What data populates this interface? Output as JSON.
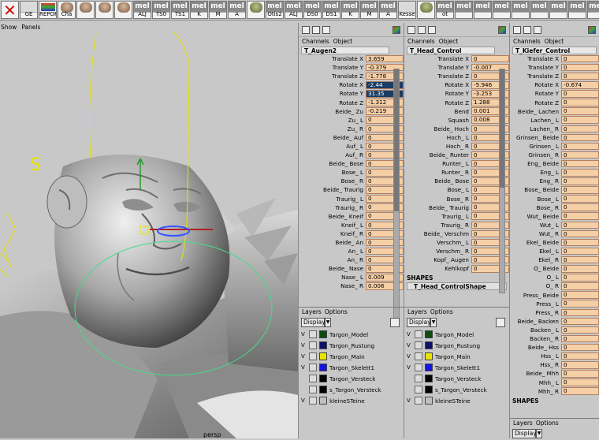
{
  "shelf": [
    {
      "label": "",
      "kind": "x"
    },
    {
      "label": "GE",
      "kind": "plain"
    },
    {
      "label": "REPORT",
      "kind": "report"
    },
    {
      "label": "Cha",
      "kind": "face"
    },
    {
      "label": "",
      "kind": "face"
    },
    {
      "label": "",
      "kind": "face"
    },
    {
      "label": "",
      "kind": "face"
    },
    {
      "label": "ALJ",
      "kind": "mel"
    },
    {
      "label": "TS0",
      "kind": "mel"
    },
    {
      "label": "TS1",
      "kind": "mel"
    },
    {
      "label": "K",
      "kind": "mel"
    },
    {
      "label": "M",
      "kind": "mel"
    },
    {
      "label": "A",
      "kind": "mel"
    },
    {
      "label": "",
      "kind": "faceg"
    },
    {
      "label": "Otis2",
      "kind": "mel"
    },
    {
      "label": "ALJ",
      "kind": "mel"
    },
    {
      "label": "DS0",
      "kind": "mel"
    },
    {
      "label": "DS1",
      "kind": "mel"
    },
    {
      "label": "K",
      "kind": "mel"
    },
    {
      "label": "M",
      "kind": "mel"
    },
    {
      "label": "A",
      "kind": "mel"
    },
    {
      "label": "Kesse",
      "kind": "plain"
    },
    {
      "label": "",
      "kind": "faceg"
    },
    {
      "label": "ot",
      "kind": "mel"
    },
    {
      "label": "",
      "kind": "mel"
    },
    {
      "label": "",
      "kind": "mel"
    },
    {
      "label": "",
      "kind": "mel"
    },
    {
      "label": "",
      "kind": "mel"
    },
    {
      "label": "",
      "kind": "mel"
    },
    {
      "label": "",
      "kind": "mel"
    },
    {
      "label": "",
      "kind": "mel"
    },
    {
      "label": "",
      "kind": "mel"
    }
  ],
  "mel_text": "mel",
  "viewport": {
    "menu": [
      "Show",
      "Panels"
    ],
    "label": "persp"
  },
  "cb_menu": [
    "Channels",
    "Object"
  ],
  "layers_menu": [
    "Layers",
    "Options"
  ],
  "display_label": "Display",
  "layers": [
    {
      "name": "Targon_Model",
      "color": "#0e4a12",
      "v": "V"
    },
    {
      "name": "Targon_Rustung",
      "color": "#10106a",
      "v": "V"
    },
    {
      "name": "Targon_Main",
      "color": "#e6e600",
      "v": "V"
    },
    {
      "name": "Targon_Skelett1",
      "color": "#1414e0",
      "v": "V"
    },
    {
      "name": "Targon_Versteck",
      "color": "#000000",
      "v": ""
    },
    {
      "name": "s_Targon_Versteck",
      "color": "#000000",
      "v": ""
    },
    {
      "name": "kleineSTeine",
      "color": "#c0c0c0",
      "v": "V"
    }
  ],
  "cb1": {
    "object": "T_Augen2",
    "channels": [
      {
        "l": "Translate X",
        "v": "3.659"
      },
      {
        "l": "Translate Y",
        "v": "-0.379"
      },
      {
        "l": "Translate Z",
        "v": "-1.778"
      },
      {
        "l": "Rotate X",
        "v": "-2.44",
        "s": true
      },
      {
        "l": "Rotate Y",
        "v": "31.35",
        "s": true
      },
      {
        "l": "Rotate Z",
        "v": "-1.312"
      },
      {
        "l": "Beide_ Zu",
        "v": "-0.219"
      },
      {
        "l": "Zu_ L",
        "v": "0"
      },
      {
        "l": "Zu_ R",
        "v": "0"
      },
      {
        "l": "Beide_ Auf",
        "v": "0"
      },
      {
        "l": "Auf_ L",
        "v": "0"
      },
      {
        "l": "Auf_ R",
        "v": "0"
      },
      {
        "l": "Beide_ Bose",
        "v": "0"
      },
      {
        "l": "Bose_ L",
        "v": "0"
      },
      {
        "l": "Bose_ R",
        "v": "0"
      },
      {
        "l": "Beide_ Traurig",
        "v": "0"
      },
      {
        "l": "Traurig_ L",
        "v": "0"
      },
      {
        "l": "Traurig_ R",
        "v": "0"
      },
      {
        "l": "Beide_ Kneif",
        "v": "0"
      },
      {
        "l": "Kneif_ L",
        "v": "0"
      },
      {
        "l": "Kneif_ R",
        "v": "0"
      },
      {
        "l": "Beide_ An",
        "v": "0"
      },
      {
        "l": "An_ L",
        "v": "0"
      },
      {
        "l": "An_ R",
        "v": "0"
      },
      {
        "l": "Beide_ Nase",
        "v": "0"
      },
      {
        "l": "Nase_ L",
        "v": "0.009"
      },
      {
        "l": "Nase_ R",
        "v": "0.006"
      }
    ]
  },
  "cb2": {
    "object": "T_Head_Control",
    "channels": [
      {
        "l": "Translate X",
        "v": "0"
      },
      {
        "l": "Translate Y",
        "v": "-0.007"
      },
      {
        "l": "Translate Z",
        "v": "0"
      },
      {
        "l": "Rotate X",
        "v": "-5.946"
      },
      {
        "l": "Rotate Y",
        "v": "-3.253"
      },
      {
        "l": "Rotate Z",
        "v": "1.288"
      },
      {
        "l": "Bend",
        "v": "0.001"
      },
      {
        "l": "Squash",
        "v": "0.008"
      },
      {
        "l": "Beide_ Hoch",
        "v": "0"
      },
      {
        "l": "Hoch_ L",
        "v": "0"
      },
      {
        "l": "Hoch_ R",
        "v": "0"
      },
      {
        "l": "Beide_ Runter",
        "v": "0"
      },
      {
        "l": "Runter_ L",
        "v": "0"
      },
      {
        "l": "Runter_ R",
        "v": "0"
      },
      {
        "l": "Beide_ Bose",
        "v": "0"
      },
      {
        "l": "Bose_ L",
        "v": "0"
      },
      {
        "l": "Bose_ R",
        "v": "0"
      },
      {
        "l": "Beide_ Traurig",
        "v": "0"
      },
      {
        "l": "Traurig_ L",
        "v": "0"
      },
      {
        "l": "Traurig_ R",
        "v": "0"
      },
      {
        "l": "Beide_ Verschm",
        "v": "0"
      },
      {
        "l": "Verschm_ L",
        "v": "0"
      },
      {
        "l": "Verschm_ R",
        "v": "0"
      },
      {
        "l": "Kopf_ Augen",
        "v": "0"
      },
      {
        "l": "Kehlkopf",
        "v": "0"
      }
    ],
    "shapes_label": "SHAPES",
    "shape": "T_Head_ControlShape"
  },
  "cb3": {
    "object": "T_Kiefer_Control",
    "channels": [
      {
        "l": "Translate X",
        "v": "0"
      },
      {
        "l": "Translate Y",
        "v": "0"
      },
      {
        "l": "Translate Z",
        "v": "0"
      },
      {
        "l": "Rotate X",
        "v": "-0.674"
      },
      {
        "l": "Rotate Y",
        "v": "0"
      },
      {
        "l": "Rotate Z",
        "v": "0"
      },
      {
        "l": "Beide_ Lachen",
        "v": "0"
      },
      {
        "l": "Lachen_ L",
        "v": "0"
      },
      {
        "l": "Lachen_ R",
        "v": "0"
      },
      {
        "l": "Grinsen_ Beide",
        "v": "0"
      },
      {
        "l": "Grinsen_ L",
        "v": "0"
      },
      {
        "l": "Grinsen_ R",
        "v": "0"
      },
      {
        "l": "Eng_ Beide",
        "v": "0"
      },
      {
        "l": "Eng_ L",
        "v": "0"
      },
      {
        "l": "Eng_ R",
        "v": "0"
      },
      {
        "l": "Bose_ Beide",
        "v": "0"
      },
      {
        "l": "Bose_ L",
        "v": "0"
      },
      {
        "l": "Bose_ R",
        "v": "0"
      },
      {
        "l": "Wut_ Beide",
        "v": "0"
      },
      {
        "l": "Wut_ L",
        "v": "0"
      },
      {
        "l": "Wut_ R",
        "v": "0"
      },
      {
        "l": "Ekel_ Beide",
        "v": "0"
      },
      {
        "l": "Ekel_ L",
        "v": "0"
      },
      {
        "l": "Ekel_ R",
        "v": "0"
      },
      {
        "l": "O_ Beide",
        "v": "0"
      },
      {
        "l": "O_ L",
        "v": "0"
      },
      {
        "l": "O_ R",
        "v": "0"
      },
      {
        "l": "Press_ Beide",
        "v": "0"
      },
      {
        "l": "Press_ L",
        "v": "0"
      },
      {
        "l": "Press_ R",
        "v": "0"
      },
      {
        "l": "Beide_ Backen",
        "v": "0"
      },
      {
        "l": "Backen_ L",
        "v": "0"
      },
      {
        "l": "Backen_ R",
        "v": "0"
      },
      {
        "l": "Beide_ Hss",
        "v": "0"
      },
      {
        "l": "Hss_ L",
        "v": "0"
      },
      {
        "l": "Hss_ R",
        "v": "0"
      },
      {
        "l": "Beide_ Mhh",
        "v": "0"
      },
      {
        "l": "Mhh_ L",
        "v": "0"
      },
      {
        "l": "Mhh_ R",
        "v": "0"
      }
    ],
    "shapes_label": "SHAPES"
  }
}
